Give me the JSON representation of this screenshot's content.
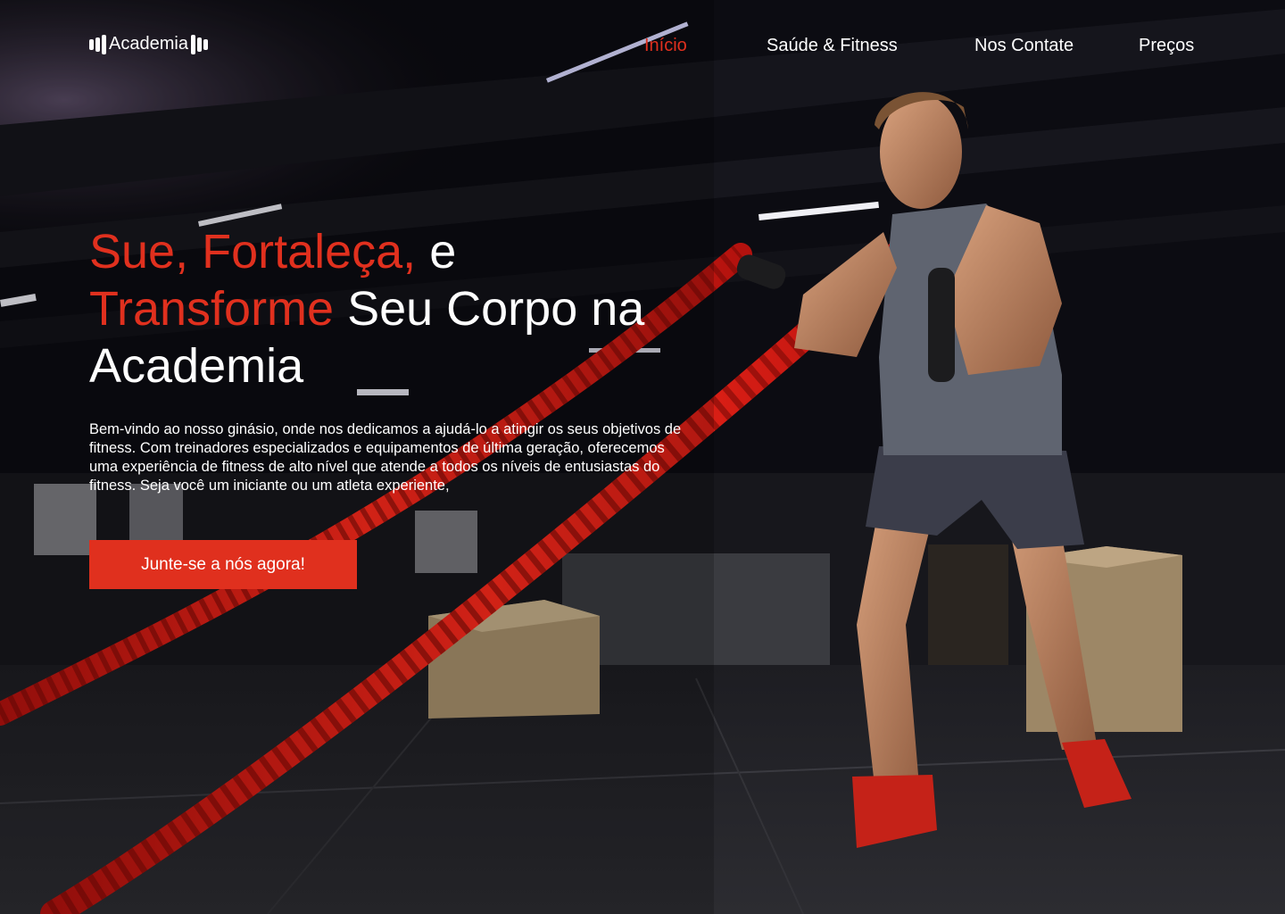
{
  "brand": {
    "logo_text": "Academia"
  },
  "nav": {
    "items": [
      {
        "label": "Início",
        "active": true
      },
      {
        "label": "Saúde & Fitness",
        "active": false
      },
      {
        "label": "Nos Contate",
        "active": false
      },
      {
        "label": "Preços",
        "active": false
      }
    ]
  },
  "hero": {
    "title_part1": "Sue, Fortaleça,",
    "title_part2": " e",
    "title_part3": "Transforme",
    "title_part4": " Seu Corpo na",
    "title_part5": "Academia",
    "description": "Bem-vindo ao nosso ginásio, onde nos dedicamos a ajudá-lo a atingir os seus objetivos de fitness. Com treinadores especializados e equipamentos de última geração, oferecemos uma experiência de fitness de alto nível que atende a todos os níveis de entusiastas do fitness. Seja você um iniciante ou um atleta experiente,",
    "cta_label": "Junte-se a nós agora!"
  },
  "colors": {
    "accent": "#e0301e",
    "text": "#ffffff",
    "background": "#0b0b0f"
  }
}
